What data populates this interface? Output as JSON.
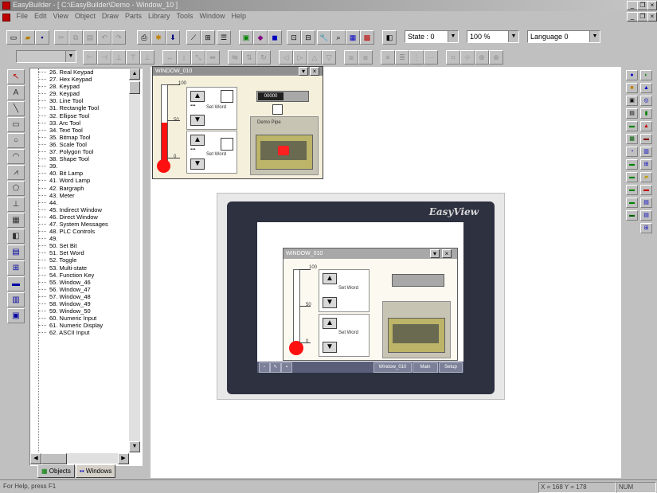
{
  "app": {
    "title": "EasyBuilder - [ C:\\EasyBuilder\\Demo - Window_10 ]",
    "brand_color": "#c00000"
  },
  "menu": [
    "File",
    "Edit",
    "View",
    "Object",
    "Draw",
    "Parts",
    "Library",
    "Tools",
    "Window",
    "Help"
  ],
  "toolbar": {
    "state_label": "State : 0",
    "zoom_label": "100 %",
    "language_label": "Language 0"
  },
  "tree": {
    "items": [
      "26. Real Keypad",
      "27. Hex Keypad",
      "28. Keypad",
      "29. Keypad",
      "30. Line Tool",
      "31. Rectangle Tool",
      "32. Ellipse Tool",
      "33. Arc Tool",
      "34. Text Tool",
      "35. Bitmap Tool",
      "36. Scale Tool",
      "37. Polygon Tool",
      "38. Shape Tool",
      "39.",
      "40. Bit Lamp",
      "41. Word Lamp",
      "42. Bargraph",
      "43. Meter",
      "44.",
      "45. Indirect Window",
      "46. Direct Window",
      "47. System Messages",
      "48. PLC Controls",
      "49.",
      "50. Set Bit",
      "51. Set Word",
      "52. Toggle",
      "53. Multi-state",
      "54. Function Key",
      "55. Window_46",
      "56. Window_47",
      "57. Window_48",
      "58. Window_49",
      "59. Window_50",
      "60. Numeric Input",
      "61. Numeric Display",
      "62. ASCII Input"
    ],
    "tab_objects": "Objects",
    "tab_windows": "Windows"
  },
  "panel": {
    "title": "WINDOW_010",
    "scale_top": "100",
    "scale_mid": "50",
    "scale_bottom": "0",
    "num_value": "00000",
    "button_text_1": "Set Word",
    "button_text_2": "Set Word",
    "pipe_label": "Demo Pipe"
  },
  "hmi": {
    "brand": "EasyView",
    "popup_title": "WINDOW_010",
    "scale_top": "100",
    "scale_mid": "50",
    "scale_bottom": "0",
    "btn1": "Set Word",
    "btn2": "Set Word",
    "footer": [
      "Window_010",
      "Main",
      "Setup"
    ]
  },
  "statusbar": {
    "help": "For Help, press F1",
    "coords": "X = 168  Y = 178",
    "mode": "NUM"
  }
}
